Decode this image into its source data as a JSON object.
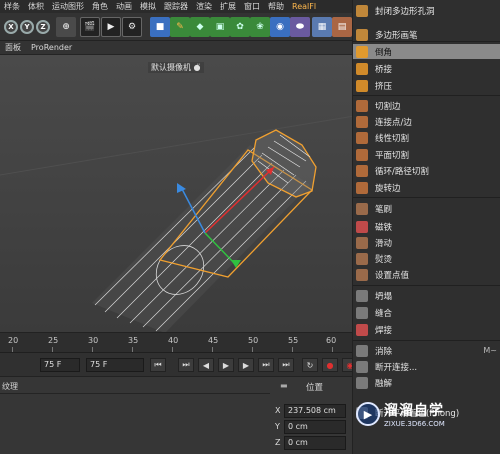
{
  "menubar": [
    "样条",
    "体积",
    "运动图形",
    "角色",
    "动画",
    "模拟",
    "跟踪器",
    "渲染",
    "扩展",
    "窗口",
    "帮助",
    "RealFl"
  ],
  "toolbar": {
    "axes": [
      "X",
      "Y",
      "Z"
    ]
  },
  "viewport_menu": [
    "面板",
    "ProRender"
  ],
  "viewport": {
    "camera_label": "默认摄像机 ●̈"
  },
  "ruler": {
    "ticks": [
      "20",
      "25",
      "30",
      "35",
      "40",
      "45",
      "50",
      "55",
      "60"
    ]
  },
  "transport": {
    "current_frame": "75 F",
    "end_frame": "75 F"
  },
  "bottom": {
    "material_tab": "纹理",
    "position_label": "位置",
    "coords": [
      {
        "axis": "X",
        "value": "237.508 cm"
      },
      {
        "axis": "Y",
        "value": "0 cm"
      },
      {
        "axis": "Z",
        "value": "0 cm"
      }
    ]
  },
  "context_menu": {
    "items": [
      {
        "label": "封闭多边形孔洞",
        "icon_color": "#c0873a"
      },
      {
        "label": "多边形画笔",
        "icon_color": "#c0873a"
      },
      {
        "label": "倒角",
        "icon_color": "#e19a2e",
        "highlight": true
      },
      {
        "label": "桥接",
        "icon_color": "#d08a2a"
      },
      {
        "label": "挤压",
        "icon_color": "#d08a2a"
      },
      {
        "label": "切割边",
        "icon_color": "#b06a3a"
      },
      {
        "label": "连接点/边",
        "icon_color": "#b06a3a"
      },
      {
        "label": "线性切割",
        "icon_color": "#b06a3a"
      },
      {
        "label": "平面切割",
        "icon_color": "#b06a3a"
      },
      {
        "label": "循环/路径切割",
        "icon_color": "#b06a3a"
      },
      {
        "label": "旋转边",
        "icon_color": "#b06a3a"
      },
      {
        "label": "笔刷",
        "icon_color": "#9a6a4a"
      },
      {
        "label": "磁铁",
        "icon_color": "#c04a4a"
      },
      {
        "label": "滑动",
        "icon_color": "#9a6a4a"
      },
      {
        "label": "熨烫",
        "icon_color": "#9a6a4a"
      },
      {
        "label": "设置点值",
        "icon_color": "#9a6a4a"
      },
      {
        "label": "坍塌",
        "icon_color": "#7a7a7a"
      },
      {
        "label": "缝合",
        "icon_color": "#7a7a7a"
      },
      {
        "label": "焊接",
        "icon_color": "#c04a4a"
      },
      {
        "label": "消除",
        "icon_color": "#7a7a7a",
        "shortcut": "M~"
      },
      {
        "label": "断开连接...",
        "icon_color": "#7a7a7a"
      },
      {
        "label": "融解",
        "icon_color": "#7a7a7a"
      },
      {
        "label": "断开平滑着色(Phong)",
        "icon_color": "#7a7a7a"
      }
    ]
  },
  "watermark": {
    "title": "溜溜自学",
    "url": "ZIXUE.3D66.COM"
  },
  "colors": {
    "highlight": "#8a8a8a",
    "accent_orange": "#f0a030",
    "bg_dark": "#2f2f2f"
  }
}
